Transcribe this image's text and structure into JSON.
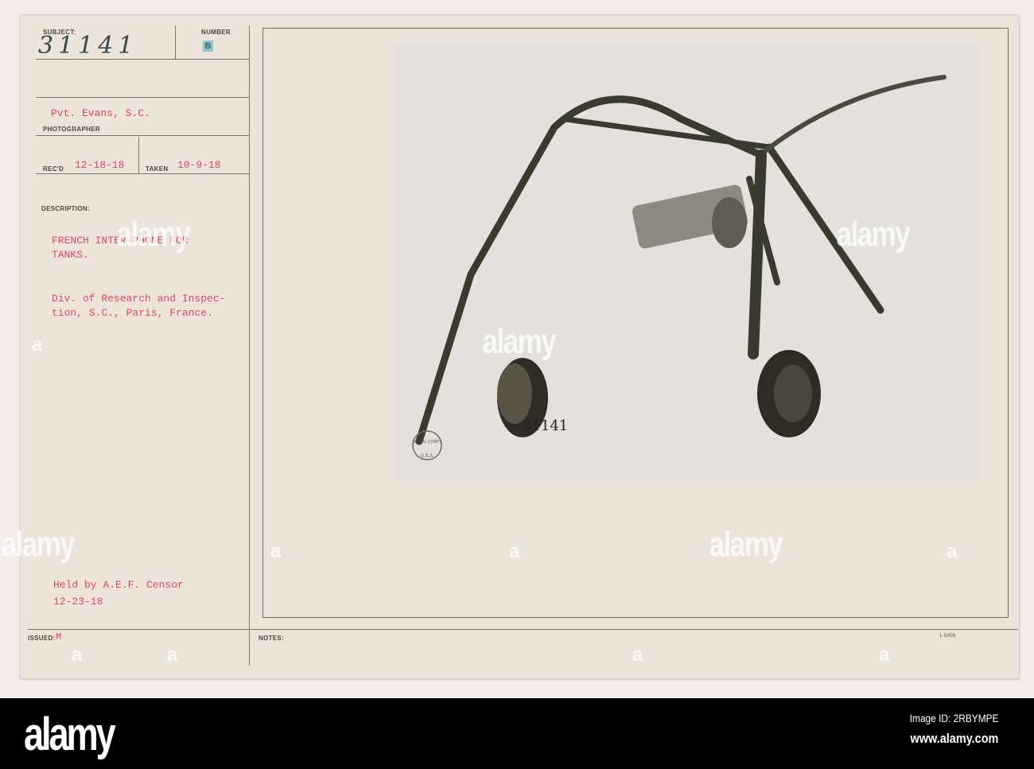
{
  "card": {
    "subject_label": "SUBJECT:",
    "subject_value": "31141",
    "number_label": "NUMBER",
    "number_stamp": "B",
    "photographer_value": "Pvt. Evans, S.C.",
    "photographer_label": "PHOTOGRAPHER",
    "recd_label": "REC'D",
    "recd_value": "12-18-18",
    "taken_label": "TAKEN",
    "taken_value": "10-9-18",
    "description_label": "DESCRIPTION:",
    "description_line1": "FRENCH INTER-PHONE FOR",
    "description_line2": "TANKS.",
    "description_line3": "Div. of Research and Inspec-",
    "description_line4": "tion, S.C., Paris, France.",
    "censor_line1": "Held by A.E.F. Censor",
    "censor_line2": "12-23-18",
    "issued_label": "ISSUED:",
    "issued_value": "M",
    "notes_label": "NOTES:",
    "form_number": "1-5005"
  },
  "photo": {
    "negative_number": "31141",
    "seal_text_top": "SIGNAL CORPS",
    "seal_text_bottom": "U.S.A."
  },
  "watermark": {
    "text": "alamy",
    "letter": "a"
  },
  "footer": {
    "logo": "alamy",
    "image_id": "Image ID: 2RBYMPE",
    "url": "www.alamy.com"
  },
  "colors": {
    "typewriter_red": "#d84a5c",
    "card": "#ece4da",
    "footer": "#000000"
  }
}
